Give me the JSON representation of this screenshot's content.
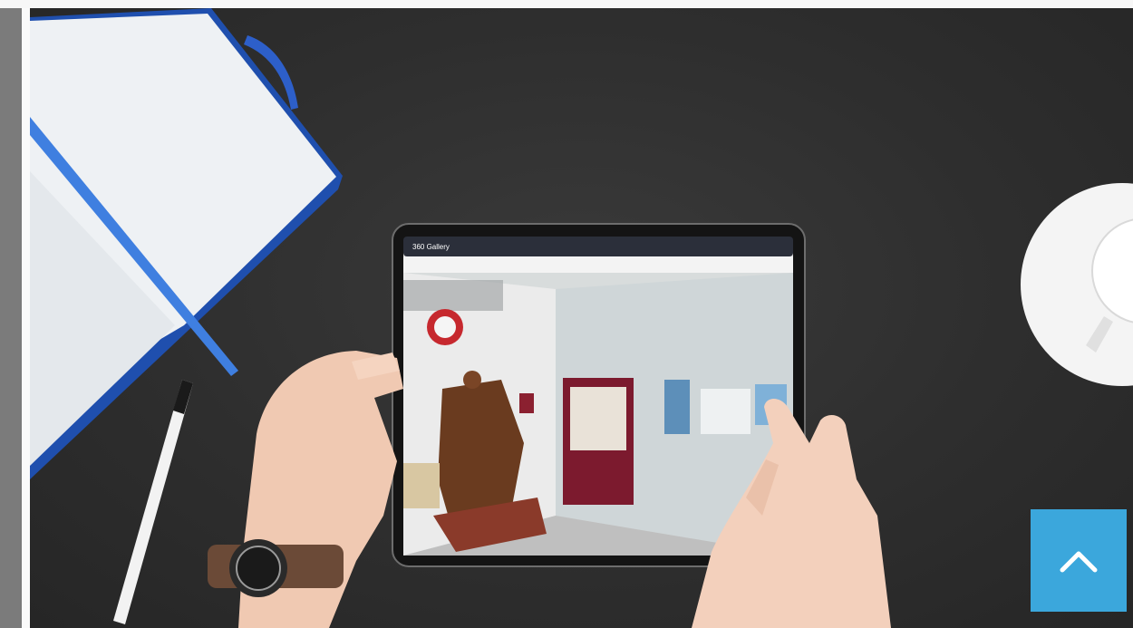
{
  "hero": {
    "image_description_icon": "photo-hero",
    "tablet_screen": {
      "app_title": "360 Gallery",
      "status_right": "●●●● ▭"
    }
  },
  "back_to_top": {
    "icon": "chevron-up-icon",
    "color": "#3ba7dc"
  }
}
